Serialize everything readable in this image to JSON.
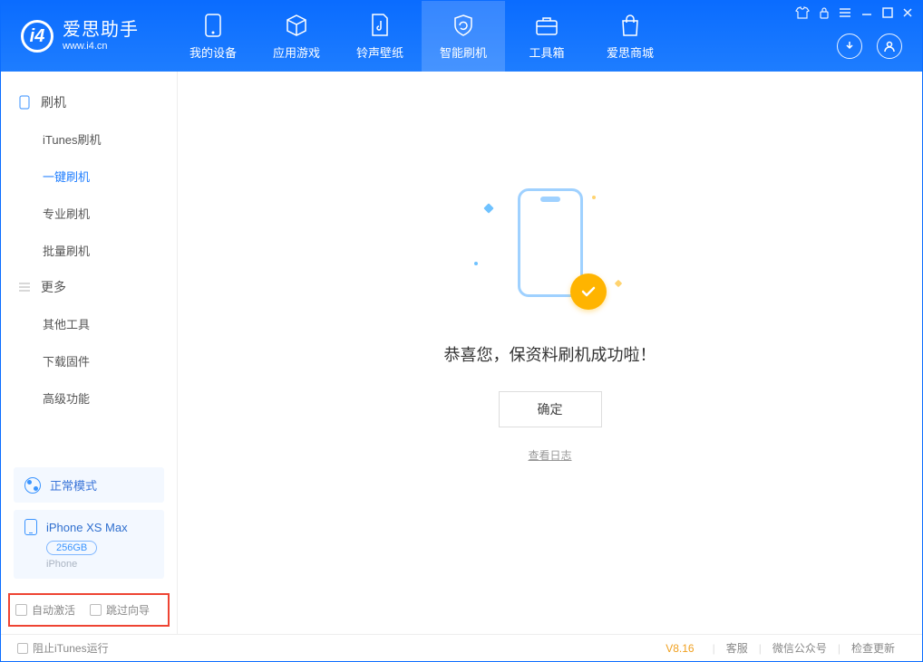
{
  "app": {
    "name_cn": "爱思助手",
    "name_en": "www.i4.cn",
    "logo_letter": "i4"
  },
  "tabs": [
    {
      "label": "我的设备"
    },
    {
      "label": "应用游戏"
    },
    {
      "label": "铃声壁纸"
    },
    {
      "label": "智能刷机"
    },
    {
      "label": "工具箱"
    },
    {
      "label": "爱思商城"
    }
  ],
  "sidebar": {
    "group1": {
      "title": "刷机",
      "items": [
        "iTunes刷机",
        "一键刷机",
        "专业刷机",
        "批量刷机"
      ]
    },
    "group2": {
      "title": "更多",
      "items": [
        "其他工具",
        "下载固件",
        "高级功能"
      ]
    }
  },
  "mode": {
    "label": "正常模式"
  },
  "device": {
    "name": "iPhone XS Max",
    "capacity": "256GB",
    "type": "iPhone"
  },
  "options": {
    "auto_activate": "自动激活",
    "skip_wizard": "跳过向导"
  },
  "main": {
    "success_msg": "恭喜您，保资料刷机成功啦！",
    "ok_label": "确定",
    "log_link": "查看日志"
  },
  "footer": {
    "block_itunes": "阻止iTunes运行",
    "version": "V8.16",
    "links": [
      "客服",
      "微信公众号",
      "检查更新"
    ]
  }
}
